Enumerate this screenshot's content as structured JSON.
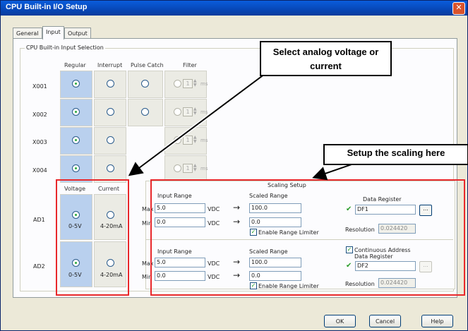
{
  "window": {
    "title": "CPU Built-in I/O Setup",
    "close_glyph": "✕"
  },
  "tabs": [
    {
      "label": "General"
    },
    {
      "label": "Input"
    },
    {
      "label": "Output"
    }
  ],
  "group": {
    "label": "CPU Built-in Input Selection",
    "headers": {
      "regular": "Regular",
      "interrupt": "Interrupt",
      "pulse_catch": "Pulse Catch",
      "filter": "Filter",
      "voltage": "Voltage",
      "current": "Current"
    },
    "rows": [
      {
        "name": "X001"
      },
      {
        "name": "X002"
      },
      {
        "name": "X003"
      },
      {
        "name": "X004"
      }
    ],
    "filter_value": "1",
    "filter_unit": "ms"
  },
  "analog": {
    "ad1": {
      "name": "AD1",
      "voltage_label": "0-5V",
      "current_label": "4-20mA"
    },
    "ad2": {
      "name": "AD2",
      "voltage_label": "0-5V",
      "current_label": "4-20mA"
    }
  },
  "scaling": {
    "title": "Scaling Setup",
    "input_range": "Input Range",
    "scaled_range": "Scaled Range",
    "max": "Max",
    "min": "Min",
    "unit": "VDC",
    "arrow": "→",
    "enable_limiter": "Enable Range Limiter",
    "data_register": "Data Register",
    "resolution": "Resolution",
    "continuous_address": "Continuous Address",
    "browse": "...",
    "ad1": {
      "in_max": "5.0",
      "in_min": "0.0",
      "sc_max": "100.0",
      "sc_min": "0.0",
      "register": "DF1",
      "resolution": "0.024420"
    },
    "ad2": {
      "in_max": "5.0",
      "in_min": "0.0",
      "sc_max": "100.0",
      "sc_min": "0.0",
      "register": "DF2",
      "resolution": "0.024420"
    }
  },
  "buttons": {
    "ok": "OK",
    "cancel": "Cancel",
    "help": "Help"
  },
  "callouts": {
    "analog": "Select analog voltage or current",
    "scaling": "Setup the scaling here"
  },
  "colors": {
    "highlight_blue": "#b9d0ee",
    "callout_red": "#e8282b"
  }
}
